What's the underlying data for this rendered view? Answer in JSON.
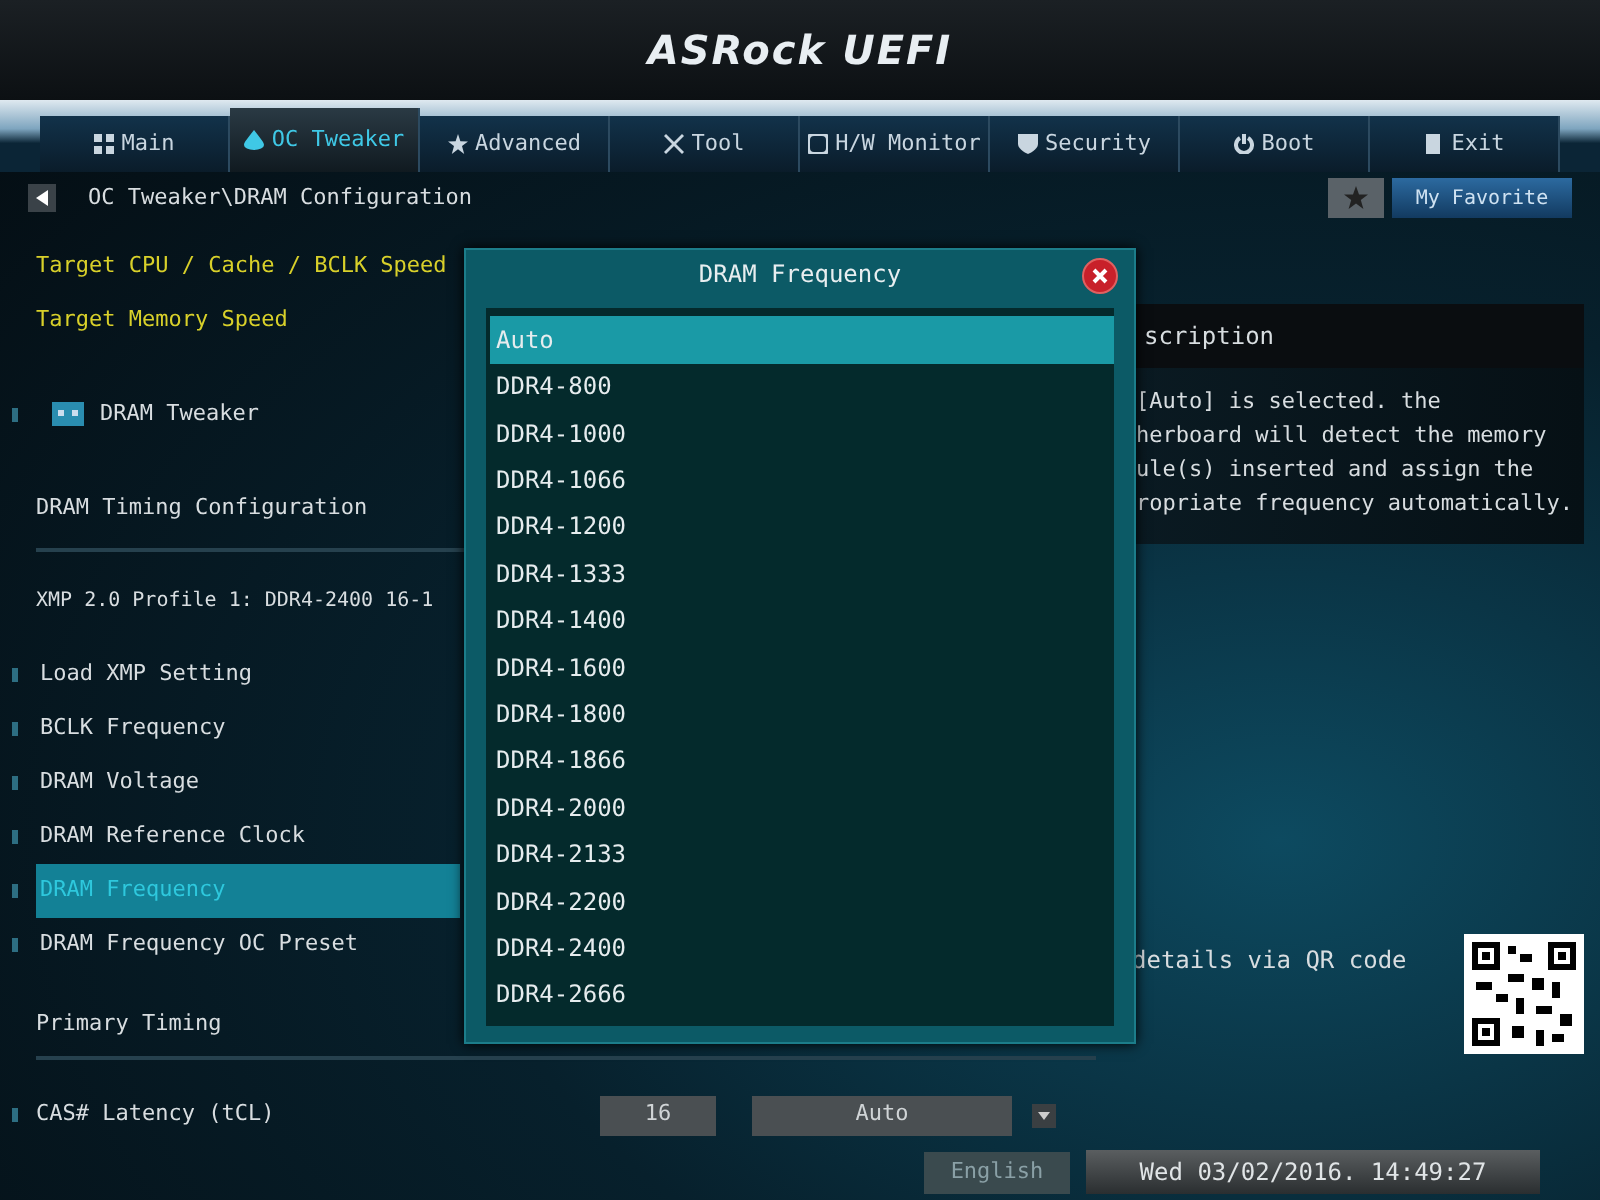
{
  "header": {
    "logo": "ASRock",
    "product": "UEFI"
  },
  "tabs": [
    {
      "label": "Main",
      "selected": false
    },
    {
      "label": "OC Tweaker",
      "selected": true
    },
    {
      "label": "Advanced",
      "selected": false
    },
    {
      "label": "Tool",
      "selected": false
    },
    {
      "label": "H/W Monitor",
      "selected": false
    },
    {
      "label": "Security",
      "selected": false
    },
    {
      "label": "Boot",
      "selected": false
    },
    {
      "label": "Exit",
      "selected": false
    }
  ],
  "breadcrumb": "OC Tweaker\\DRAM Configuration",
  "favorite_button": "My Favorite",
  "settings": [
    {
      "kind": "info",
      "label": "Target CPU / Cache / BCLK Speed"
    },
    {
      "kind": "info",
      "label": "Target Memory Speed"
    },
    {
      "kind": "submenu",
      "label": "DRAM Tweaker"
    },
    {
      "kind": "header",
      "label": "DRAM Timing Configuration"
    },
    {
      "kind": "text",
      "label": "XMP 2.0 Profile 1: DDR4-2400 16-1"
    },
    {
      "kind": "setting",
      "label": "Load XMP Setting",
      "selected": false
    },
    {
      "kind": "setting",
      "label": "BCLK Frequency",
      "selected": false
    },
    {
      "kind": "setting",
      "label": "DRAM Voltage",
      "selected": false
    },
    {
      "kind": "setting",
      "label": "DRAM Reference Clock",
      "selected": false
    },
    {
      "kind": "setting",
      "label": "DRAM Frequency",
      "selected": true
    },
    {
      "kind": "setting",
      "label": "DRAM Frequency OC Preset",
      "selected": false
    },
    {
      "kind": "header",
      "label": "Primary Timing"
    },
    {
      "kind": "value",
      "label": "CAS# Latency (tCL)",
      "selected": false,
      "value": "16",
      "option": "Auto"
    }
  ],
  "description": {
    "title": "scription",
    "lines": [
      "[Auto] is selected. the",
      "herboard will detect the memory",
      "ule(s) inserted and assign the",
      "ropriate frequency automatically."
    ]
  },
  "qr_caption": "details via QR code",
  "dialog": {
    "title": "DRAM Frequency",
    "options": [
      {
        "label": "Auto",
        "selected": true
      },
      {
        "label": "DDR4-800",
        "selected": false
      },
      {
        "label": "DDR4-1000",
        "selected": false
      },
      {
        "label": "DDR4-1066",
        "selected": false
      },
      {
        "label": "DDR4-1200",
        "selected": false
      },
      {
        "label": "DDR4-1333",
        "selected": false
      },
      {
        "label": "DDR4-1400",
        "selected": false
      },
      {
        "label": "DDR4-1600",
        "selected": false
      },
      {
        "label": "DDR4-1800",
        "selected": false
      },
      {
        "label": "DDR4-1866",
        "selected": false
      },
      {
        "label": "DDR4-2000",
        "selected": false
      },
      {
        "label": "DDR4-2133",
        "selected": false
      },
      {
        "label": "DDR4-2200",
        "selected": false
      },
      {
        "label": "DDR4-2400",
        "selected": false
      },
      {
        "label": "DDR4-2666",
        "selected": false
      }
    ]
  },
  "footer": {
    "language": "English",
    "datetime": "Wed 03/02/2016. 14:49:27"
  }
}
